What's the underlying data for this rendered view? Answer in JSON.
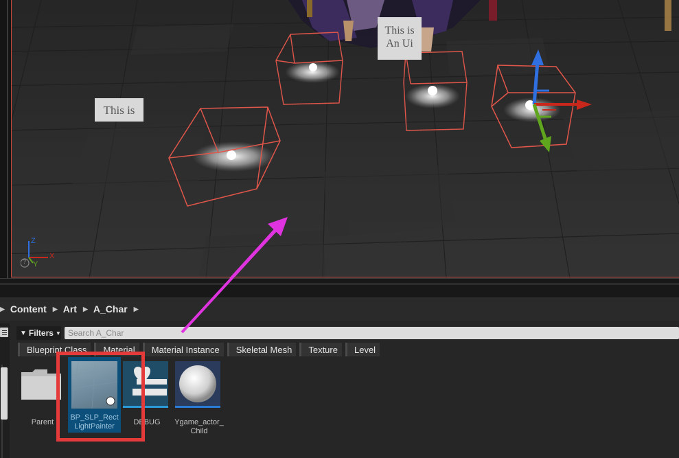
{
  "viewport": {
    "signs": [
      "This is",
      "This is An Ui"
    ],
    "axis_labels": {
      "z": "Z",
      "x": "X",
      "y": "Y"
    },
    "help_glyph": "?"
  },
  "browser": {
    "breadcrumb": [
      "Content",
      "Art",
      "A_Char"
    ],
    "filters_label": "Filters",
    "search_placeholder": "Search A_Char",
    "filter_chips": [
      "Blueprint Class",
      "Material",
      "Material Instance",
      "Skeletal Mesh",
      "Texture",
      "Level"
    ],
    "assets": [
      {
        "name": "Parent",
        "icon": "folder-icon",
        "selected": false
      },
      {
        "name": "BP_SLP_Rect LightPainter",
        "icon": "blueprint-thumbnail",
        "selected": true
      },
      {
        "name": "DEBUG",
        "icon": "debug-heart-icon",
        "selected": false
      },
      {
        "name": "Ygame_actor_ Child",
        "icon": "sphere-thumbnail",
        "selected": false
      }
    ]
  },
  "colors": {
    "selection_blue": "#0b4f7a",
    "annotation_arrow": "#e033e0",
    "highlight_red": "#e53a3a",
    "bounds_red": "#e0564a"
  }
}
